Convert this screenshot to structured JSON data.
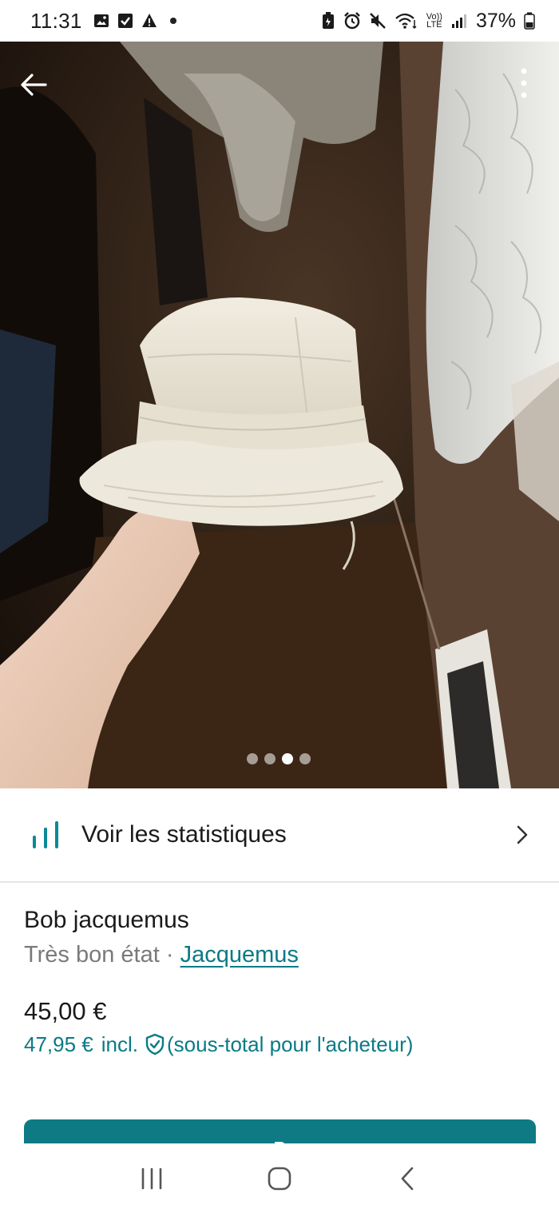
{
  "status_bar": {
    "time": "11:31",
    "network": "LTE",
    "volte": "Vo))",
    "battery": "37%"
  },
  "photo": {
    "image_count": 4,
    "active_index": 2
  },
  "stats": {
    "label": "Voir les statistiques"
  },
  "item": {
    "title": "Bob jacquemus",
    "condition": "Très bon état",
    "separator": " · ",
    "brand": "Jacquemus",
    "price": "45,00 €",
    "buyer_price": "47,95 €",
    "buyer_incl": "incl.",
    "buyer_note": "(sous-total pour l'acheteur)"
  },
  "buy_button": {
    "label": "Β"
  },
  "colors": {
    "accent": "#0a7a85",
    "button": "#0d7a84"
  }
}
